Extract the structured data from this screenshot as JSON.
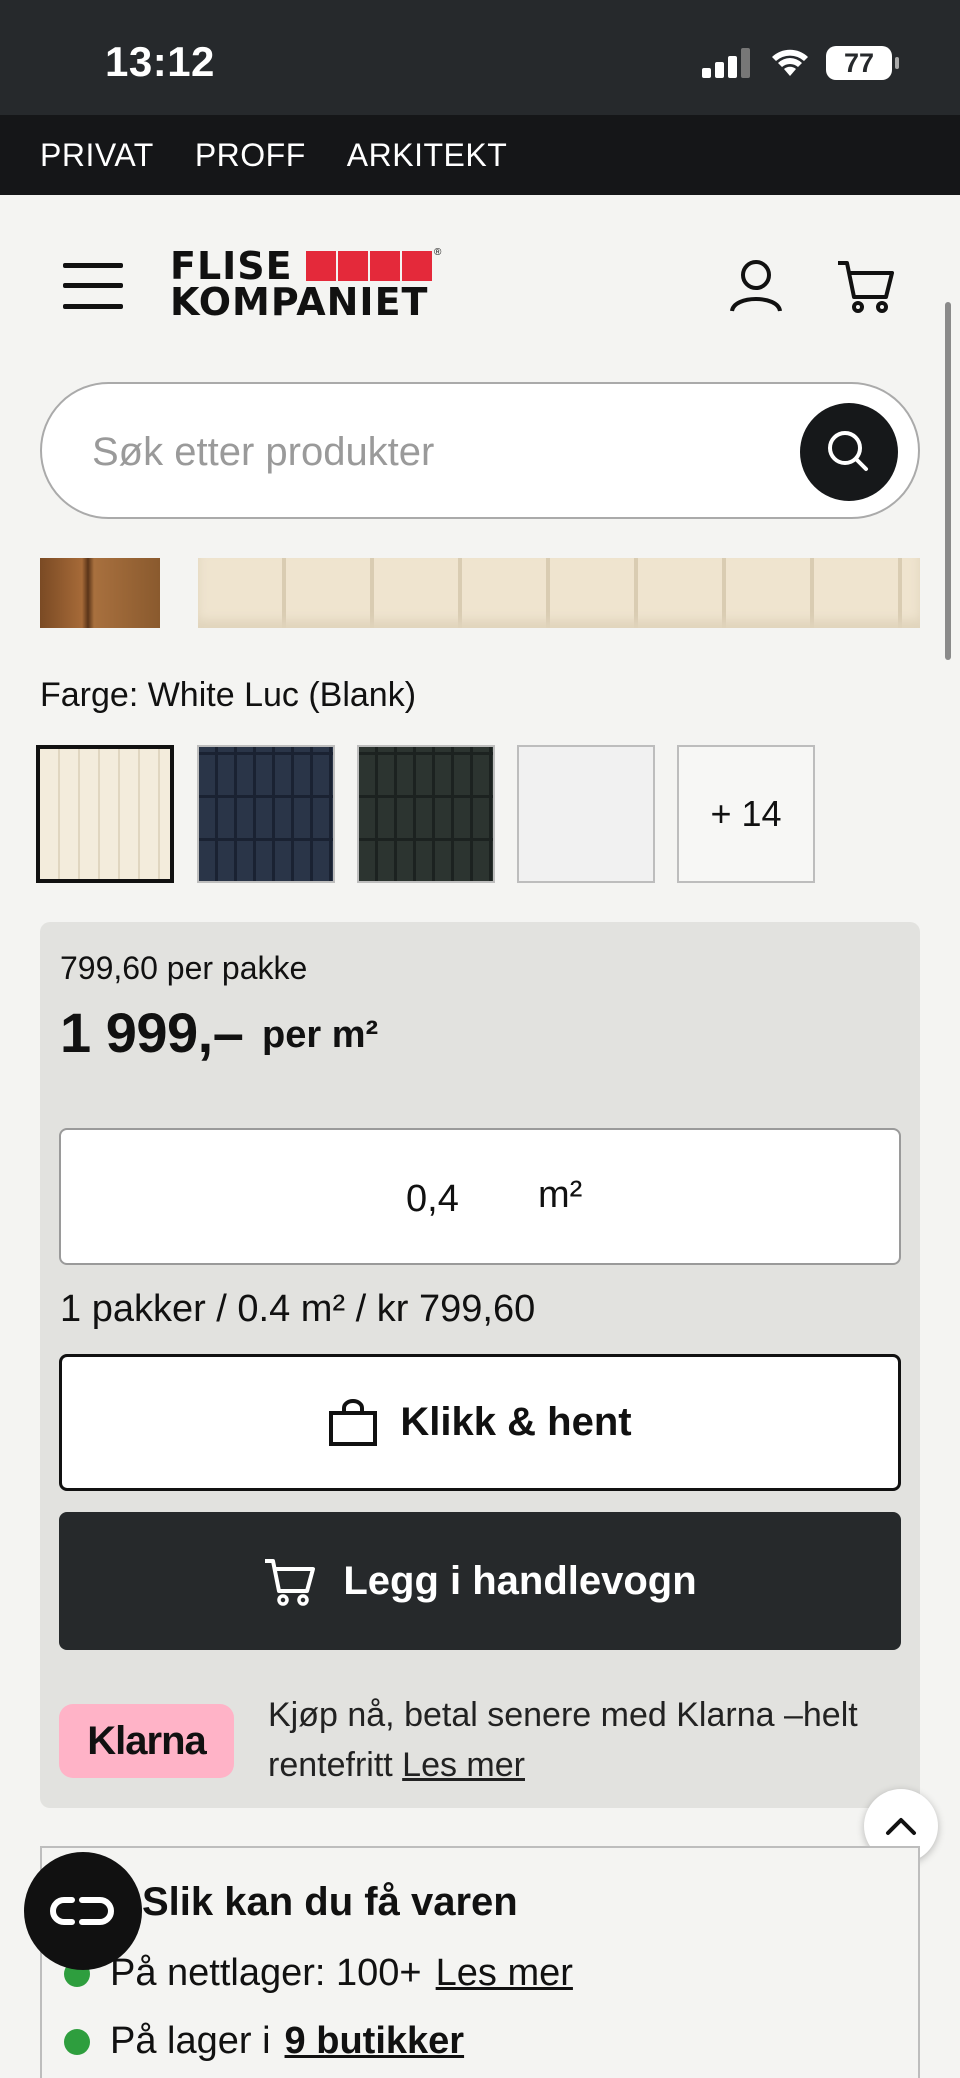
{
  "status_bar": {
    "time": "13:12",
    "battery": "77"
  },
  "top_nav": {
    "items": [
      "PRIVAT",
      "PROFF",
      "ARKITEKT"
    ]
  },
  "logo": {
    "line1": "FLISE",
    "line2": "KOMPANIET"
  },
  "search": {
    "placeholder": "Søk etter produkter"
  },
  "product": {
    "color_label": "Farge: White Luc (Blank)",
    "more_colors": "+ 14",
    "price_per_pack": "799,60 per pakke",
    "price": "1 999,–",
    "price_unit": "per m²",
    "quantity_value": "0,4",
    "quantity_unit": "m²",
    "pack_summary": "1 pakker / 0.4 m² / kr 799,60",
    "pickup_button": "Klikk & hent",
    "cart_button": "Legg i handlevogn"
  },
  "klarna": {
    "badge": "Klarna",
    "text": "Kjøp nå, betal senere med Klarna –helt rentefritt",
    "link": "Les mer"
  },
  "delivery": {
    "title": "Slik kan du få varen",
    "online_label": "På nettlager: 100+",
    "online_link": "Les mer",
    "store_label": "På lager i",
    "store_link": "9 butikker"
  },
  "colors": {
    "accent_red": "#e4293a",
    "dark": "#26292b",
    "klarna_pink": "#ffb3c7",
    "stock_green": "#2e9e3e"
  }
}
